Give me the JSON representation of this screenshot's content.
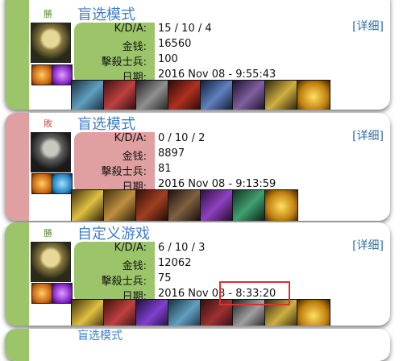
{
  "colors": {
    "win": "#9cc56a",
    "loss": "#e0a0a2",
    "win_text": "#5a8a2a",
    "loss_text": "#c85050",
    "highlight": "#d93030"
  },
  "labels": {
    "kda": "K/D/A:",
    "gold": "金钱:",
    "minions": "擊殺士兵:",
    "date": "日期:",
    "detail": "[详细]"
  },
  "matches": [
    {
      "result": "勝",
      "outcome": "win",
      "mode": "盲选模式",
      "kda": "15 / 10 / 4",
      "gold": "16560",
      "minions": "100",
      "date": "2016 Nov 08 - 9:55:43",
      "champion_icon": "spiked-champion-icon",
      "spells": [
        "flash-spell-icon",
        "purple-spell-icon"
      ],
      "items": [
        "helmet-item-icon",
        "blade-item-icon",
        "armor-item-icon",
        "sword-item-icon",
        "staff-item-icon",
        "dagger-item-icon",
        "dagger-item-icon",
        "trinket-item-icon"
      ]
    },
    {
      "result": "敗",
      "outcome": "loss",
      "mode": "盲选模式",
      "kda": "0 / 10 / 2",
      "gold": "8897",
      "minions": "81",
      "date": "2016 Nov 08 - 9:13:59",
      "champion_icon": "skull-champion-icon",
      "spells": [
        "flash-spell-icon",
        "blue-spell-icon"
      ],
      "items": [
        "shield-item-icon",
        "blade-item-icon",
        "boots-item-icon",
        "staff-item-icon",
        "sword-item-icon",
        "axe-item-icon",
        "trinket-item-icon"
      ]
    },
    {
      "result": "勝",
      "outcome": "win",
      "mode": "自定义游戏",
      "kda": "6 / 10 / 3",
      "gold": "12062",
      "minions": "75",
      "date": "2016 Nov 08 - 8:33:20",
      "champion_icon": "spiked-champion-icon",
      "spells": [
        "flash-spell-icon",
        "purple-spell-icon"
      ],
      "items": [
        "boots-item-icon",
        "blade-item-icon",
        "gem-item-icon",
        "helmet-item-icon",
        "dagger-item-icon",
        "sword-item-icon",
        "dagger-item-icon",
        "trinket-item-icon"
      ]
    }
  ],
  "partial_next_mode": "盲选模式"
}
